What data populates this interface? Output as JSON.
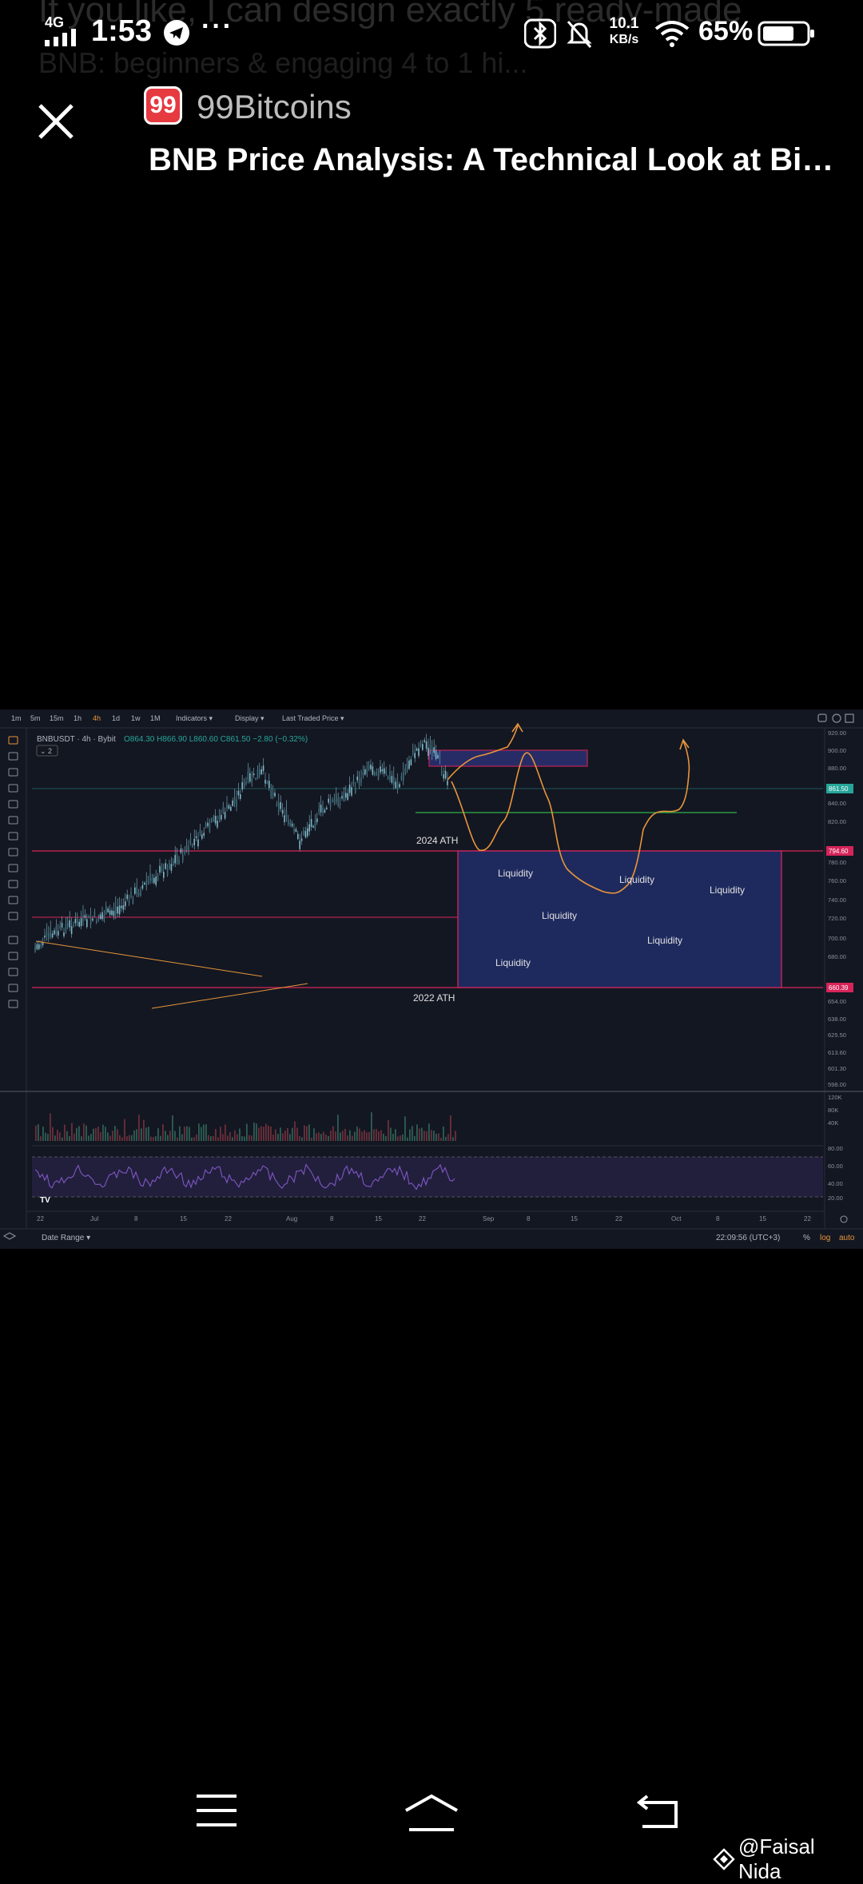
{
  "status_bar": {
    "network": "4G",
    "time": "1:53",
    "speed_value": "10.1",
    "speed_unit": "KB/s",
    "battery": "65%",
    "background_text_line1": "If you like, I can design exactly 5 ready-made",
    "background_text_line2": "BNB: beginners & engaging 4 to 1 hi..."
  },
  "header": {
    "source_logo_text": "99",
    "source_name": "99Bitcoins",
    "article_title": "BNB Price Analysis: A Technical Look at Bin…"
  },
  "chart": {
    "timeframes": [
      "1m",
      "5m",
      "15m",
      "1h",
      "4h",
      "1d",
      "1w",
      "1M"
    ],
    "active_timeframe": "4h",
    "menus": [
      "Indicators ▾",
      "Display ▾",
      "Last Traded Price ▾"
    ],
    "symbol": "BNBUSDT · 4h · Bybit",
    "ohlc": "O864.30 H866.90 L860.60 C861.50 −2.80 (−0.32%)",
    "layer_badge": "⌄ 2",
    "labels": {
      "ath_2024": "2024 ATH",
      "ath_2022": "2022 ATH",
      "liquidity": "Liquidity"
    },
    "price_axis": [
      "920.00",
      "900.00",
      "880.00",
      "861.50",
      "840.00",
      "820.00",
      "794.60",
      "780.00",
      "760.00",
      "740.00",
      "720.00",
      "700.00",
      "680.00",
      "660.39",
      "654.00",
      "638.00",
      "625.50",
      "613.60",
      "601.30",
      "598.00"
    ],
    "price_tags": {
      "current": "861.50",
      "ath_2024": "794.60",
      "ath_2022": "660.39"
    },
    "volume_axis": [
      "120K",
      "80K",
      "40K"
    ],
    "rsi_axis": [
      "80.00",
      "60.00",
      "40.00",
      "20.00"
    ],
    "time_axis": [
      "22",
      "Jul",
      "8",
      "15",
      "22",
      "Aug",
      "8",
      "15",
      "22",
      "Sep",
      "8",
      "15",
      "22",
      "Oct",
      "8",
      "15",
      "22"
    ],
    "footer_left": "Date Range ▾",
    "footer_time": "22:09:56 (UTC+3)",
    "footer_pct": "%",
    "footer_log": "log",
    "footer_auto": "auto",
    "colors": {
      "background": "#131722",
      "candle": "#7fb8c8",
      "zone": "#1e2a5e",
      "zone_border": "#d6245a",
      "projection": "#e8953a",
      "support": "#2db34a",
      "rsi": "#7e57c2"
    }
  },
  "watermark": {
    "handle": "@Faisal Nida"
  }
}
